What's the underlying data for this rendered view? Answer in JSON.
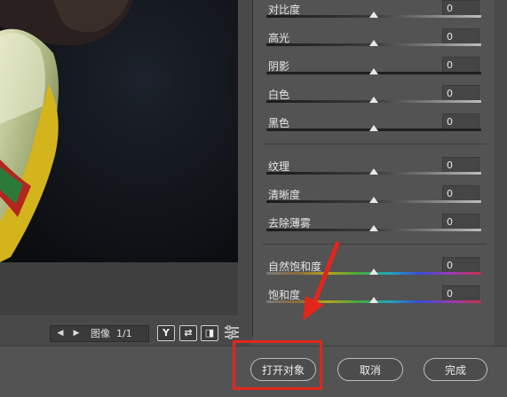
{
  "navigator": {
    "prev_icon": "triangle-left-icon",
    "next_icon": "triangle-right-icon",
    "image_label": "图像",
    "image_counter": "1/1",
    "tools": [
      {
        "name": "y-toggle-icon",
        "glyph": "Y"
      },
      {
        "name": "swap-icon",
        "glyph": "⇄"
      },
      {
        "name": "before-after-icon",
        "glyph": "◨"
      },
      {
        "name": "preferences-sliders-icon",
        "glyph": ""
      }
    ]
  },
  "adjustments": {
    "groups": [
      [
        {
          "label": "对比度",
          "value": "0",
          "track": "gray",
          "fraction": 0.5
        },
        {
          "label": "高光",
          "value": "0",
          "track": "gray",
          "fraction": 0.5
        },
        {
          "label": "阴影",
          "value": "0",
          "track": "dark",
          "fraction": 0.5
        },
        {
          "label": "白色",
          "value": "0",
          "track": "gray",
          "fraction": 0.5
        },
        {
          "label": "黑色",
          "value": "0",
          "track": "dark",
          "fraction": 0.5
        }
      ],
      [
        {
          "label": "纹理",
          "value": "0",
          "track": "gray",
          "fraction": 0.5
        },
        {
          "label": "清晰度",
          "value": "0",
          "track": "gray",
          "fraction": 0.5
        },
        {
          "label": "去除薄雾",
          "value": "0",
          "track": "gray",
          "fraction": 0.5
        }
      ],
      [
        {
          "label": "自然饱和度",
          "value": "0",
          "track": "rainbow",
          "fraction": 0.5
        },
        {
          "label": "饱和度",
          "value": "0",
          "track": "rainbow",
          "fraction": 0.5
        }
      ]
    ]
  },
  "footer": {
    "open_object_label": "打开对象",
    "cancel_label": "取消",
    "done_label": "完成"
  },
  "annotation": {
    "color": "#e2261b"
  }
}
